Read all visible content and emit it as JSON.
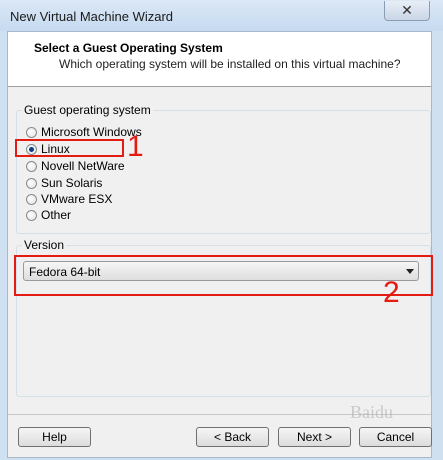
{
  "window": {
    "title": "New Virtual Machine Wizard",
    "close_glyph": "✕"
  },
  "header": {
    "title": "Select a Guest Operating System",
    "subtitle": "Which operating system will be installed on this virtual machine?"
  },
  "guest_os": {
    "label": "Guest operating system",
    "options": [
      "Microsoft Windows",
      "Linux",
      "Novell NetWare",
      "Sun Solaris",
      "VMware ESX",
      "Other"
    ],
    "selected": "Linux"
  },
  "version": {
    "label": "Version",
    "value": "Fedora 64-bit"
  },
  "annotations": {
    "one": "1",
    "two": "2",
    "color": "#e41b13"
  },
  "buttons": {
    "help": "Help",
    "back": "< Back",
    "next": "Next >",
    "cancel": "Cancel"
  },
  "watermark": "Baidu"
}
